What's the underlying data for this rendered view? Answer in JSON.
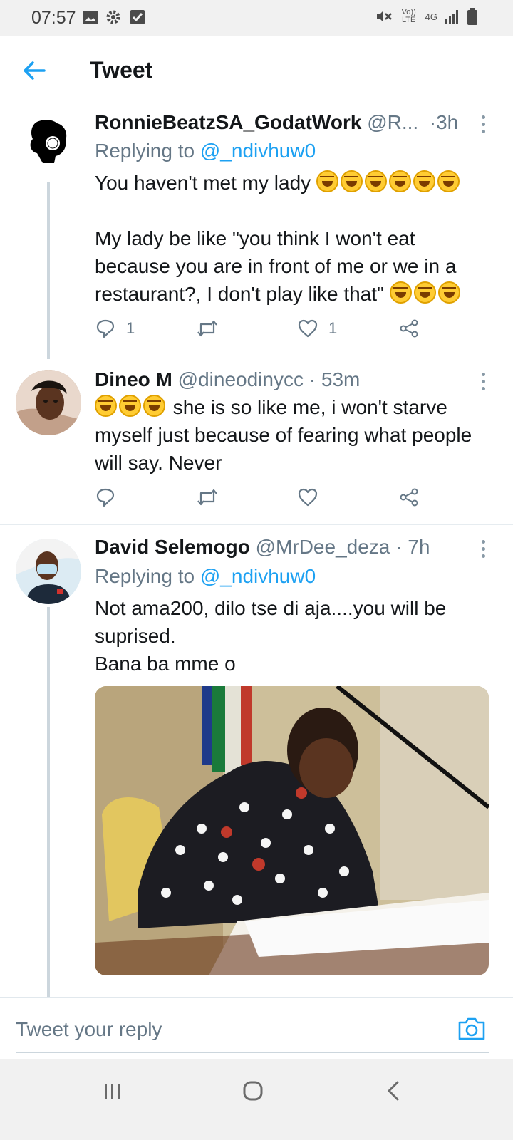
{
  "status_bar": {
    "time": "07:57",
    "icons_left": [
      "image-icon",
      "gear-icon",
      "check-box-icon"
    ],
    "volte": "Vo)) LTE",
    "network": "4G",
    "icons_right": [
      "mute-icon",
      "signal-icon",
      "battery-icon"
    ]
  },
  "header": {
    "title": "Tweet"
  },
  "tweets": [
    {
      "name": "RonnieBeatzSA_GodatWork",
      "handle": "@R...",
      "time": "3h",
      "replying_label": "Replying to",
      "replying_to": "@_ndivhuw0",
      "text_line1": "You haven't met my lady",
      "text_rest": "My lady be like \"you think I won't eat because you are in front of me or we in a restaurant?, I don't play like that\"",
      "reply_count": "1",
      "like_count": "1"
    },
    {
      "name": "Dineo M",
      "handle": "@dineodinycc",
      "time": "53m",
      "text": "she is so like me, i won't starve myself just because of fearing what people will say. Never"
    },
    {
      "name": "David Selemogo",
      "handle": "@MrDee_deza",
      "time": "7h",
      "replying_label": "Replying to",
      "replying_to": "@_ndivhuw0",
      "text": "Not ama200, dilo tse di aja....you will be suprised.\nBana ba mme o"
    }
  ],
  "reply_bar": {
    "placeholder": "Tweet your reply"
  },
  "colors": {
    "accent": "#1da1f2",
    "secondary_text": "#657786",
    "divider": "#e6ecf0"
  }
}
